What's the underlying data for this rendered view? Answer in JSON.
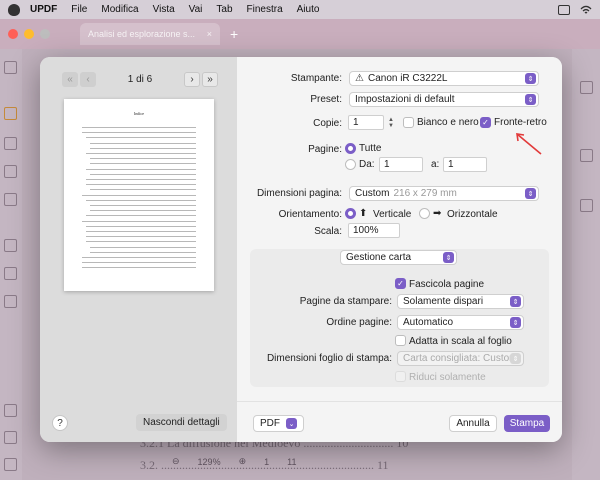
{
  "menubar": {
    "app_name": "UPDF",
    "items": [
      "File",
      "Modifica",
      "Vista",
      "Vai",
      "Tab",
      "Finestra",
      "Aiuto"
    ]
  },
  "window": {
    "tab_title": "Analisi ed esplorazione s...",
    "colors": {
      "close": "#ff5f57",
      "minimize": "#febc2e",
      "zoom": "#bdbdbd"
    }
  },
  "background_document": {
    "line1": "3.2.1 La diffusione nel Medioevo .............................. 10",
    "line2": "3.2. ....................................................................... 11",
    "zoom": "129%",
    "page_current": "1",
    "page_total": "11"
  },
  "preview": {
    "page_indicator": "1 di 6",
    "thumb_title": "Indice",
    "help_label": "?",
    "hide_details_label": "Nascondi dettagli"
  },
  "settings": {
    "printer": {
      "label": "Stampante:",
      "value": "Canon iR C3222L"
    },
    "preset": {
      "label": "Preset:",
      "value": "Impostazioni di default"
    },
    "copies": {
      "label": "Copie:",
      "value": "1"
    },
    "bw": {
      "label": "Bianco e nero",
      "checked": false
    },
    "duplex": {
      "label": "Fronte-retro",
      "checked": true
    },
    "pages": {
      "label": "Pagine:",
      "all_label": "Tutte",
      "from_label": "Da:",
      "from_value": "1",
      "to_label": "a:",
      "to_value": "1",
      "selected": "all"
    },
    "paper_size": {
      "label": "Dimensioni pagina:",
      "value": "Custom",
      "dims": "216 x 279 mm"
    },
    "orientation": {
      "label": "Orientamento:",
      "portrait_label": "Verticale",
      "landscape_label": "Orizzontale",
      "selected": "portrait"
    },
    "scale": {
      "label": "Scala:",
      "value": "100%"
    },
    "section": {
      "value": "Gestione carta"
    },
    "collate": {
      "label": "Fascicola pagine",
      "checked": true
    },
    "pages_to_print": {
      "label": "Pagine da stampare:",
      "value": "Solamente dispari"
    },
    "page_order": {
      "label": "Ordine pagine:",
      "value": "Automatico"
    },
    "scale_to_fit": {
      "label": "Adatta in scala al foglio",
      "checked": false
    },
    "dest_paper": {
      "label": "Dimensioni foglio di stampa:",
      "value": "Carta consigliata: Custom"
    },
    "reduce_only": {
      "label": "Riduci solamente"
    }
  },
  "footer": {
    "pdf_label": "PDF",
    "cancel_label": "Annulla",
    "print_label": "Stampa"
  },
  "accent_color": "#7b5ec7",
  "annotation_arrow_color": "#e23a3a"
}
